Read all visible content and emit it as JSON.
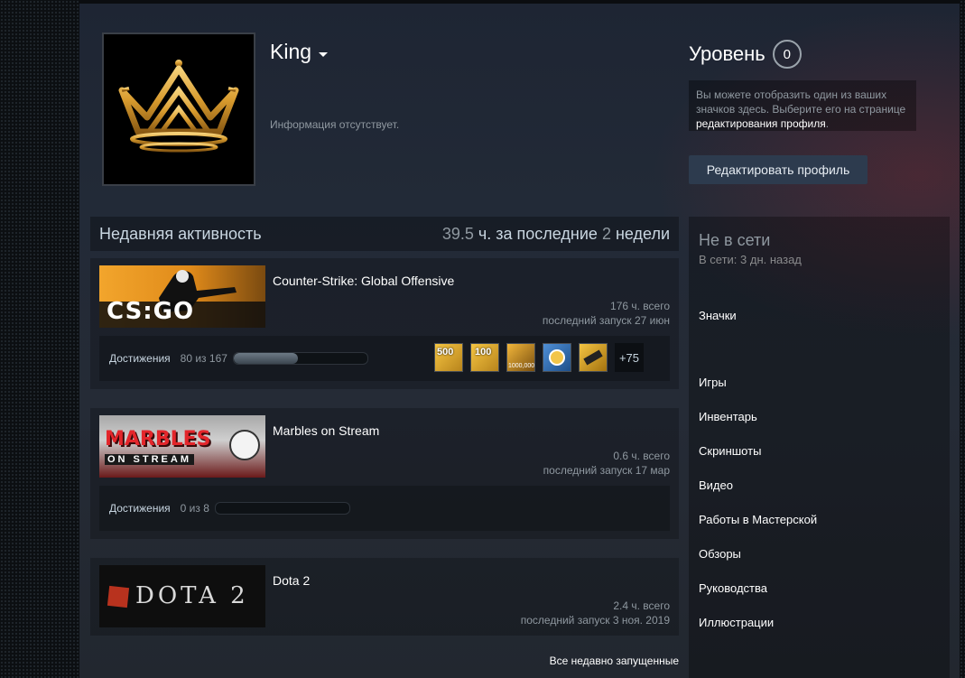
{
  "profile": {
    "name": "King",
    "summary": "Информация отсутствует.",
    "avatar_icon": "crown-icon"
  },
  "level": {
    "label": "Уровень",
    "value": "0"
  },
  "badge_note": {
    "text": "Вы можете отобразить один из ваших значков здесь. Выберите его на странице",
    "link": "редактирования профиля",
    "suffix": "."
  },
  "edit_button": "Редактировать профиль",
  "activity": {
    "title": "Недавняя активность",
    "hours_num": "39.5",
    "hours_unit": "ч. за последние",
    "weeks_num": "2",
    "weeks_unit": "недели",
    "games": [
      {
        "name": "Counter-Strike: Global Offensive",
        "total": "176 ч. всего",
        "last": "последний запуск 27 июн",
        "ach_label": "Достижения",
        "ach_count": "80 из 167",
        "ach_fraction": 0.479,
        "more": "+75"
      },
      {
        "name": "Marbles on Stream",
        "total": "0.6 ч. всего",
        "last": "последний запуск 17 мар",
        "ach_label": "Достижения",
        "ach_count": "0 из 8",
        "ach_fraction": 0
      },
      {
        "name": "Dota 2",
        "total": "2.4 ч. всего",
        "last": "последний запуск 3 ноя. 2019"
      }
    ],
    "recent_link": "Все недавно запущенные"
  },
  "sidebar": {
    "status": "Не в сети",
    "last_online": "В сети: 3 дн. назад",
    "badges": "Значки",
    "links": [
      "Игры",
      "Инвентарь",
      "Скриншоты",
      "Видео",
      "Работы в Мастерской",
      "Обзоры",
      "Руководства",
      "Иллюстрации"
    ]
  },
  "images": {
    "csgo_text": "CS:GO",
    "marbles_top": "MARBLES",
    "marbles_bottom": "ON STREAM",
    "dota_text": "DOTA 2",
    "ach_badges": [
      "500",
      "100",
      "1000,000"
    ]
  },
  "colors": {
    "accent_button": "#2d3b4e",
    "gold": "#d8a640",
    "csgo_orange": "#e59a22"
  }
}
